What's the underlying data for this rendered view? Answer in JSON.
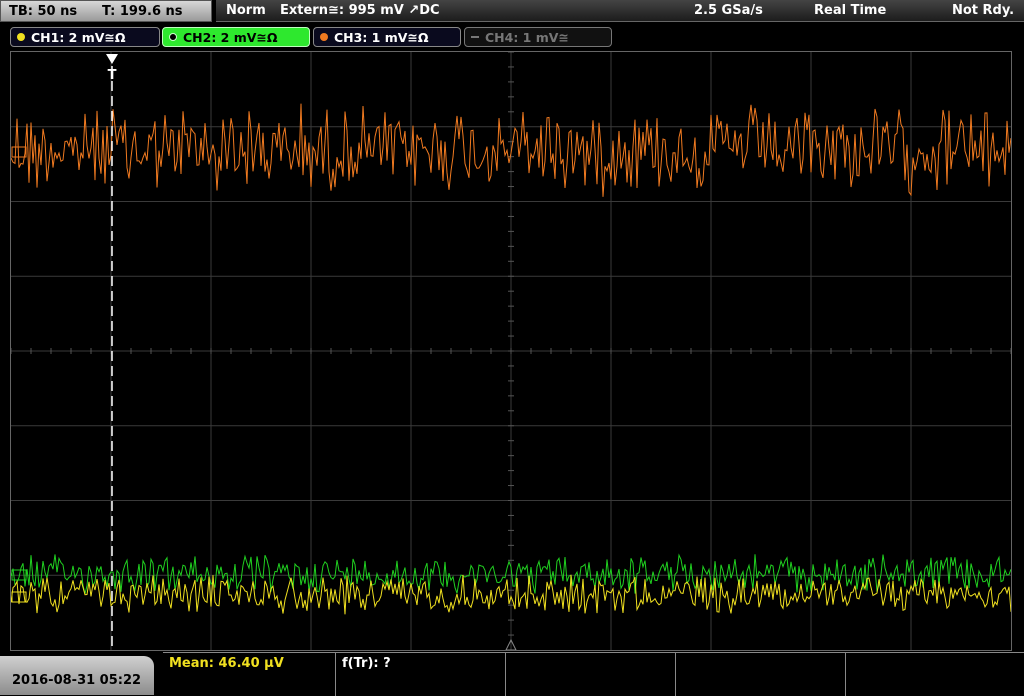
{
  "topbar": {
    "timebase": "TB: 50 ns",
    "trigger_time": "T: 199.6 ns",
    "trigger_mode": "Norm",
    "trigger_source": "Extern≅: 995 mV ↗DC",
    "sample_rate": "2.5 GSa/s",
    "acq_mode": "Real Time",
    "status": "Not Rdy."
  },
  "channels": [
    {
      "label": "CH1: 2 mV≅Ω",
      "color": "#f0e020"
    },
    {
      "label": "CH2: 2 mV≅Ω",
      "color": "#20d020"
    },
    {
      "label": "CH3: 1 mV≅Ω",
      "color": "#f07a20"
    },
    {
      "label": "CH4: 1 mV≅",
      "color": "#777777"
    }
  ],
  "trigger_marker": "T",
  "bottom": {
    "datetime": "2016-08-31 05:22",
    "mean": "Mean: 46.40 µV",
    "freq": "f(Tr): ?"
  }
}
